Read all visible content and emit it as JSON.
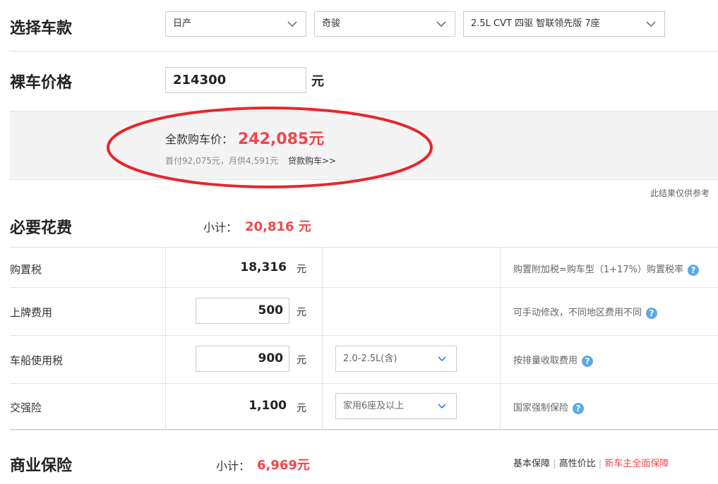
{
  "select_car": {
    "title": "选择车款",
    "brand": "日产",
    "model": "奇骏",
    "trim": "2.5L CVT 四驱 智联领先版 7座"
  },
  "bare_price": {
    "title": "裸车价格",
    "value": "214300",
    "unit": "元"
  },
  "result": {
    "label": "全款购车价：",
    "total": "242,085元",
    "detail": "首付92,075元，月供4,591元",
    "loan_link": "贷款购车>>",
    "disclaimer": "此结果仅供参考"
  },
  "necessary": {
    "title": "必要花费",
    "subtotal_label": "小计：",
    "subtotal_value": "20,816 元",
    "rows": [
      {
        "label": "购置税",
        "value": "18,316",
        "unit": "元",
        "note": "购置附加税=购车型（1+17%）购置税率"
      },
      {
        "label": "上牌费用",
        "value": "500",
        "unit": "元",
        "note": "可手动修改，不同地区费用不同"
      },
      {
        "label": "车船使用税",
        "value": "900",
        "unit": "元",
        "option": "2.0-2.5L(含)",
        "note": "按排量收取费用"
      },
      {
        "label": "交强险",
        "value": "1,100",
        "unit": "元",
        "option": "家用6座及以上",
        "note": "国家强制保险"
      }
    ]
  },
  "commercial": {
    "title": "商业保险",
    "subtotal_label": "小计：",
    "subtotal_value": "6,969元",
    "options": [
      "基本保障",
      "高性价比",
      "新车主全面保障"
    ]
  },
  "colors": {
    "accent_red": "#f0474b",
    "help_blue": "#5aa9e8",
    "annotation_red": "#e8262b"
  },
  "icons": {
    "dropdown": "chevron-down-icon",
    "help": "question-circle-icon"
  }
}
